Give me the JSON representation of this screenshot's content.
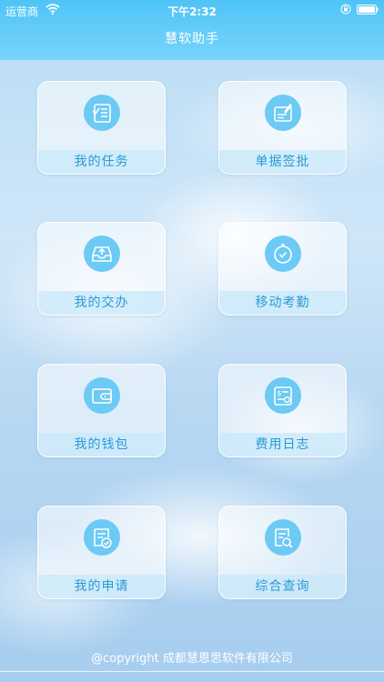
{
  "status_bar": {
    "carrier": "运营商",
    "time": "下午2:32"
  },
  "header": {
    "title": "慧软助手"
  },
  "tiles": [
    {
      "label": "我的任务",
      "icon": "task-list-icon"
    },
    {
      "label": "单据签批",
      "icon": "document-sign-icon"
    },
    {
      "label": "我的交办",
      "icon": "inbox-upload-icon"
    },
    {
      "label": "移动考勤",
      "icon": "clock-check-icon"
    },
    {
      "label": "我的钱包",
      "icon": "wallet-icon"
    },
    {
      "label": "费用日志",
      "icon": "expense-log-icon"
    },
    {
      "label": "我的申请",
      "icon": "application-check-icon"
    },
    {
      "label": "综合查询",
      "icon": "search-document-icon"
    }
  ],
  "footer": {
    "copyright": "@copyright 成都慧恩思软件有限公司"
  },
  "colors": {
    "header": "#4fc3f7",
    "accent": "#2a9ad6",
    "icon_bg": "#6ccaf5"
  }
}
